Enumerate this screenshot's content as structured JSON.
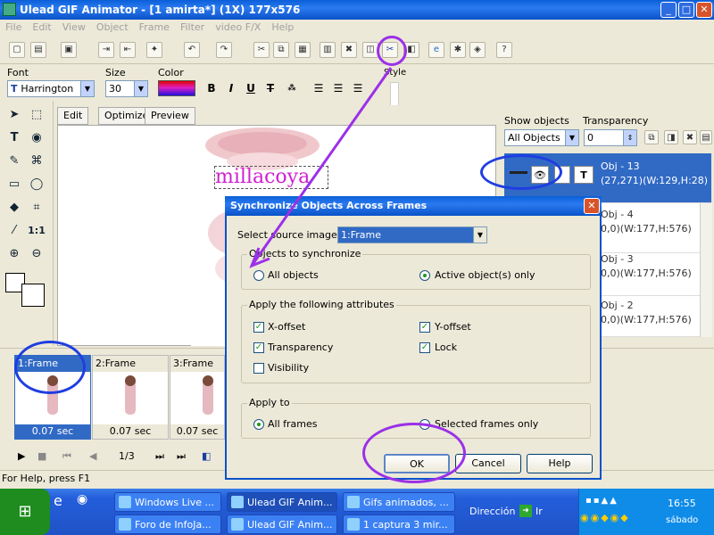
{
  "window": {
    "title": "Ulead GIF Animator - [1 amirta*] (1X) 177x576"
  },
  "menu": [
    "File",
    "Edit",
    "View",
    "Object",
    "Frame",
    "Filter",
    "video F/X",
    "Help"
  ],
  "format": {
    "font_label": "Font",
    "font_value": "Harrington",
    "size_label": "Size",
    "size_value": "30",
    "color_label": "Color",
    "bold": "B",
    "italic": "I",
    "underline": "U",
    "strike": "T",
    "style_label": "Style"
  },
  "editor_tabs": [
    "Edit",
    "Optimize",
    "Preview"
  ],
  "canvas": {
    "text_object": "millacoya"
  },
  "objects_panel": {
    "show_label": "Show objects",
    "show_value": "All Objects",
    "transparency_label": "Transparency",
    "transparency_value": "0",
    "rows": [
      {
        "name": "Obj - 13",
        "info": "(27,271)(W:129,H:28)",
        "selected": true
      },
      {
        "name": "Obj - 4",
        "info": "0,0)(W:177,H:576)",
        "selected": false
      },
      {
        "name": "Obj - 3",
        "info": "0,0)(W:177,H:576)",
        "selected": false
      },
      {
        "name": "Obj - 2",
        "info": "0,0)(W:177,H:576)",
        "selected": false
      }
    ]
  },
  "frames": [
    {
      "label": "1:Frame",
      "duration": "0.07 sec",
      "selected": true
    },
    {
      "label": "2:Frame",
      "duration": "0.07 sec",
      "selected": false
    },
    {
      "label": "3:Frame",
      "duration": "0.07 sec",
      "selected": false
    }
  ],
  "playbar": {
    "counter": "1/3"
  },
  "status": {
    "text": "For Help, press F1"
  },
  "dialog": {
    "title": "Synchronize Objects Across Frames",
    "source_label": "Select source image:",
    "source_value": "1:Frame",
    "objects_group": "Objects to synchronize",
    "all_objects": "All objects",
    "active_objects": "Active object(s) only",
    "attributes_group": "Apply the following attributes",
    "x_offset": "X-offset",
    "y_offset": "Y-offset",
    "transparency": "Transparency",
    "lock": "Lock",
    "visibility": "Visibility",
    "apply_group": "Apply to",
    "all_frames": "All frames",
    "selected_frames": "Selected frames only",
    "ok": "OK",
    "cancel": "Cancel",
    "help": "Help",
    "checked": {
      "x_offset": true,
      "y_offset": true,
      "transparency": true,
      "lock": true,
      "visibility": false
    }
  },
  "taskbar": {
    "row1": [
      "Windows Live ...",
      "Ulead GIF Anim...",
      "Gifs animados, ..."
    ],
    "row2": [
      "Foro de InfoJa...",
      "Ulead GIF Anim...",
      "1 captura 3 mir..."
    ],
    "address_label": "Dirección",
    "go_label": "Ir",
    "time": "16:55",
    "day": "sábado"
  },
  "colors": {
    "accent": "#316ac5",
    "annotation_blue": "#1f3ee0",
    "annotation_purple": "#9b30e8",
    "text_object": "#d020d0"
  }
}
